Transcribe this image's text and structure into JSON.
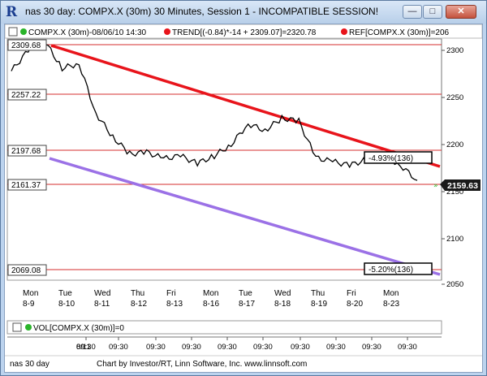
{
  "window": {
    "title": "nas 30 day: COMPX.X (30m) 30 Minutes, Session 1 - INCOMPATIBLE SESSION!",
    "minimize": "—",
    "maximize": "□",
    "close": "✕"
  },
  "header": {
    "series_label": "COMPX.X (30m)-08/06/10 14:30",
    "trend_label": "TREND[(-0.84)*-14 + 2309.07]=2320.78",
    "ref_label": "REF[COMPX.X (30m)]=206"
  },
  "price_labels": [
    "2309.68",
    "2257.22",
    "2197.68",
    "2161.37",
    "2069.08"
  ],
  "current_price": "2159.63",
  "boxes": [
    "-4.93%(136)",
    "-5.20%(136)"
  ],
  "y_ticks": [
    "2300",
    "2250",
    "2200",
    "2150",
    "2100",
    "2050"
  ],
  "x_days": [
    {
      "d": "Mon",
      "n": "8-9"
    },
    {
      "d": "Tue",
      "n": "8-10"
    },
    {
      "d": "Wed",
      "n": "8-11"
    },
    {
      "d": "Thu",
      "n": "8-12"
    },
    {
      "d": "Fri",
      "n": "8-13"
    },
    {
      "d": "Mon",
      "n": "8-16"
    },
    {
      "d": "Tue",
      "n": "8-17"
    },
    {
      "d": "Wed",
      "n": "8-18"
    },
    {
      "d": "Thu",
      "n": "8-19"
    },
    {
      "d": "Fri",
      "n": "8-20"
    },
    {
      "d": "Mon",
      "n": "8-23"
    }
  ],
  "volume_label": "VOL[COMPX.X (30m)]=0",
  "bottom_ticks": [
    "8/11",
    "09:30",
    "09:30",
    "09:30",
    "09:30",
    "09:30",
    "09:30",
    "09:30",
    "09:30",
    "09:30",
    "09:30"
  ],
  "footer": {
    "left": "nas 30 day",
    "center": "Chart by Investor/RT, Linn Software, Inc. www.linnsoft.com"
  },
  "colors": {
    "trend": "#e8141b",
    "channel": "#9b71e6",
    "level": "#d42c2c",
    "bar": "#000000"
  },
  "chart_data": {
    "type": "line",
    "x": [
      "8-9",
      "8-9",
      "8-9",
      "8-10",
      "8-10",
      "8-11",
      "8-11",
      "8-12",
      "8-12",
      "8-13",
      "8-13",
      "8-16",
      "8-16",
      "8-17",
      "8-17",
      "8-18",
      "8-18",
      "8-18",
      "8-19",
      "8-19",
      "8-20",
      "8-20",
      "8-23",
      "8-23",
      "8-23"
    ],
    "values": [
      2278,
      2300,
      2309,
      2281,
      2286,
      2233,
      2208,
      2190,
      2192,
      2185,
      2188,
      2180,
      2188,
      2200,
      2222,
      2215,
      2228,
      2225,
      2186,
      2182,
      2178,
      2184,
      2190,
      2178,
      2162
    ],
    "ylim": [
      2040,
      2315
    ],
    "series": [
      {
        "name": "COMPX.X (30m)",
        "values": [
          2278,
          2300,
          2309,
          2281,
          2286,
          2233,
          2208,
          2190,
          2192,
          2185,
          2188,
          2180,
          2188,
          2200,
          2222,
          2215,
          2228,
          2225,
          2186,
          2182,
          2178,
          2184,
          2190,
          2178,
          2162
        ]
      }
    ]
  }
}
